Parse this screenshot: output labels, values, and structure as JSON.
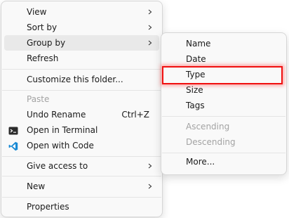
{
  "context_menu": {
    "items": [
      {
        "label": "View"
      },
      {
        "label": "Sort by"
      },
      {
        "label": "Group by"
      },
      {
        "label": "Refresh"
      },
      {
        "label": "Customize this folder..."
      },
      {
        "label": "Paste"
      },
      {
        "label": "Undo Rename",
        "shortcut": "Ctrl+Z"
      },
      {
        "label": "Open in Terminal",
        "icon": "terminal-icon"
      },
      {
        "label": "Open with Code",
        "icon": "vscode-icon"
      },
      {
        "label": "Give access to"
      },
      {
        "label": "New"
      },
      {
        "label": "Properties"
      }
    ]
  },
  "group_by_submenu": {
    "items": [
      {
        "label": "Name"
      },
      {
        "label": "Date"
      },
      {
        "label": "Type"
      },
      {
        "label": "Size"
      },
      {
        "label": "Tags"
      },
      {
        "label": "Ascending",
        "disabled": true
      },
      {
        "label": "Descending",
        "disabled": true
      },
      {
        "label": "More..."
      }
    ]
  },
  "colors": {
    "menu_background": "#f9f9f9",
    "hover_background": "#e9e9e9",
    "disabled_text": "#a3a3a3",
    "annotation_box": "#f01010",
    "vscode_blue": "#1a8ad4"
  }
}
